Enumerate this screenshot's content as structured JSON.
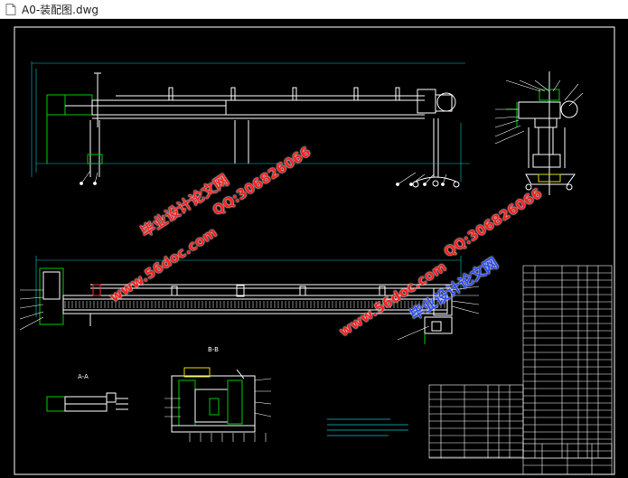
{
  "window": {
    "title": "A0-装配图.dwg"
  },
  "icons": {
    "file": "dwg-file-icon"
  },
  "drawing": {
    "section_aa": "A-A",
    "section_bb": "B-B"
  },
  "watermarks": {
    "site": "www.56doc.com",
    "brand": "毕业设计论文网",
    "qq": "QQ:306826066"
  },
  "colors": {
    "canvas_bg": "#000000",
    "line_white": "#ffffff",
    "line_green": "#00c800",
    "line_cyan": "#00c8c8",
    "line_yellow": "#e0e000",
    "line_red": "#ff3030",
    "watermark_red": "#ff2020",
    "watermark_blue": "#2b4cff"
  }
}
